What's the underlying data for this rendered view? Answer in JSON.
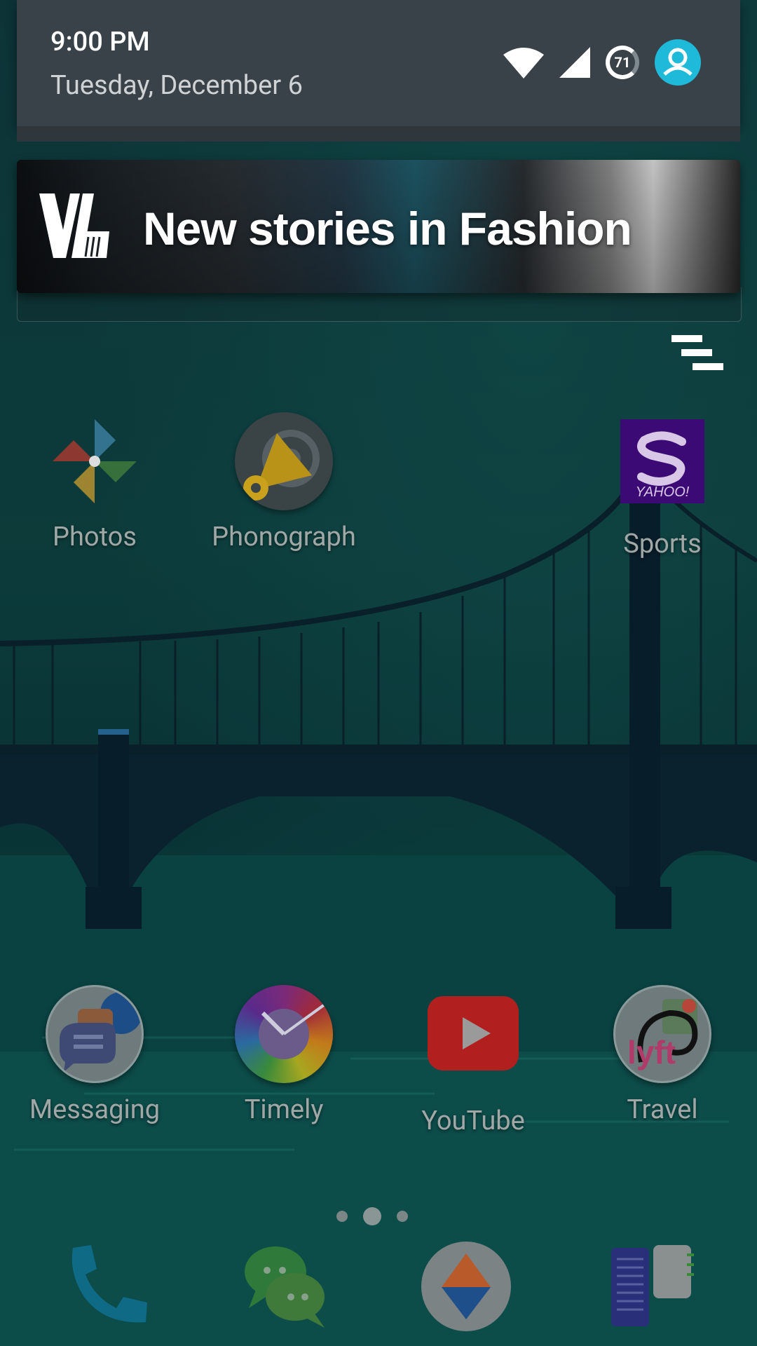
{
  "status": {
    "time": "9:00 PM",
    "date": "Tuesday, December 6",
    "battery_level": "71",
    "icons": [
      "wifi-icon",
      "cell-signal-icon",
      "battery-icon",
      "user-avatar-icon"
    ]
  },
  "notification": {
    "app_icon": "verge-logo-icon",
    "title": "New stories in Fashion"
  },
  "controls": {
    "clear_all_icon": "clear-all-icon"
  },
  "home": {
    "top_row": [
      {
        "label": "Photos",
        "icon": "photos-pinwheel-icon"
      },
      {
        "label": "Phonograph",
        "icon": "phonograph-icon"
      },
      {
        "label": "Sports",
        "icon": "yahoo-sports-icon"
      }
    ],
    "bottom_row": [
      {
        "label": "Messaging",
        "icon": "messaging-folder-icon"
      },
      {
        "label": "Timely",
        "icon": "timely-clock-icon"
      },
      {
        "label": "YouTube",
        "icon": "youtube-icon"
      },
      {
        "label": "Travel",
        "icon": "travel-folder-icon"
      }
    ],
    "pages": {
      "count": 3,
      "active": 2
    }
  },
  "dock": [
    {
      "icon": "phone-icon"
    },
    {
      "icon": "chat-bubbles-icon"
    },
    {
      "icon": "navigation-compass-icon"
    },
    {
      "icon": "notes-icon"
    }
  ],
  "colors": {
    "accent_avatar": "#1fb9d9",
    "youtube_red": "#b21f1f",
    "sports_purple": "#3b0a74",
    "header_bg": "#3a4249"
  }
}
